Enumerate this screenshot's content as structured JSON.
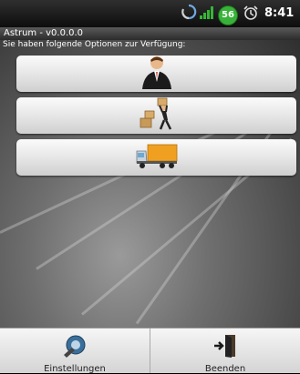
{
  "statusbar": {
    "icons": [
      "sync-icon",
      "signal-icon",
      "battery-icon",
      "alarm-icon"
    ],
    "battery_level": "56",
    "time": "8:41"
  },
  "app": {
    "title": "Astrum - v0.0.0.0",
    "subtitle": "Sie haben folgende Optionen zur Verfügung:"
  },
  "options": [
    {
      "icon": "businessman-icon"
    },
    {
      "icon": "delivery-worker-icon"
    },
    {
      "icon": "truck-icon"
    }
  ],
  "bottom_bar": {
    "settings_label": "Einstellungen",
    "exit_label": "Beenden"
  },
  "colors": {
    "battery": "#38b238",
    "titlebar": "#3c3c3c"
  }
}
